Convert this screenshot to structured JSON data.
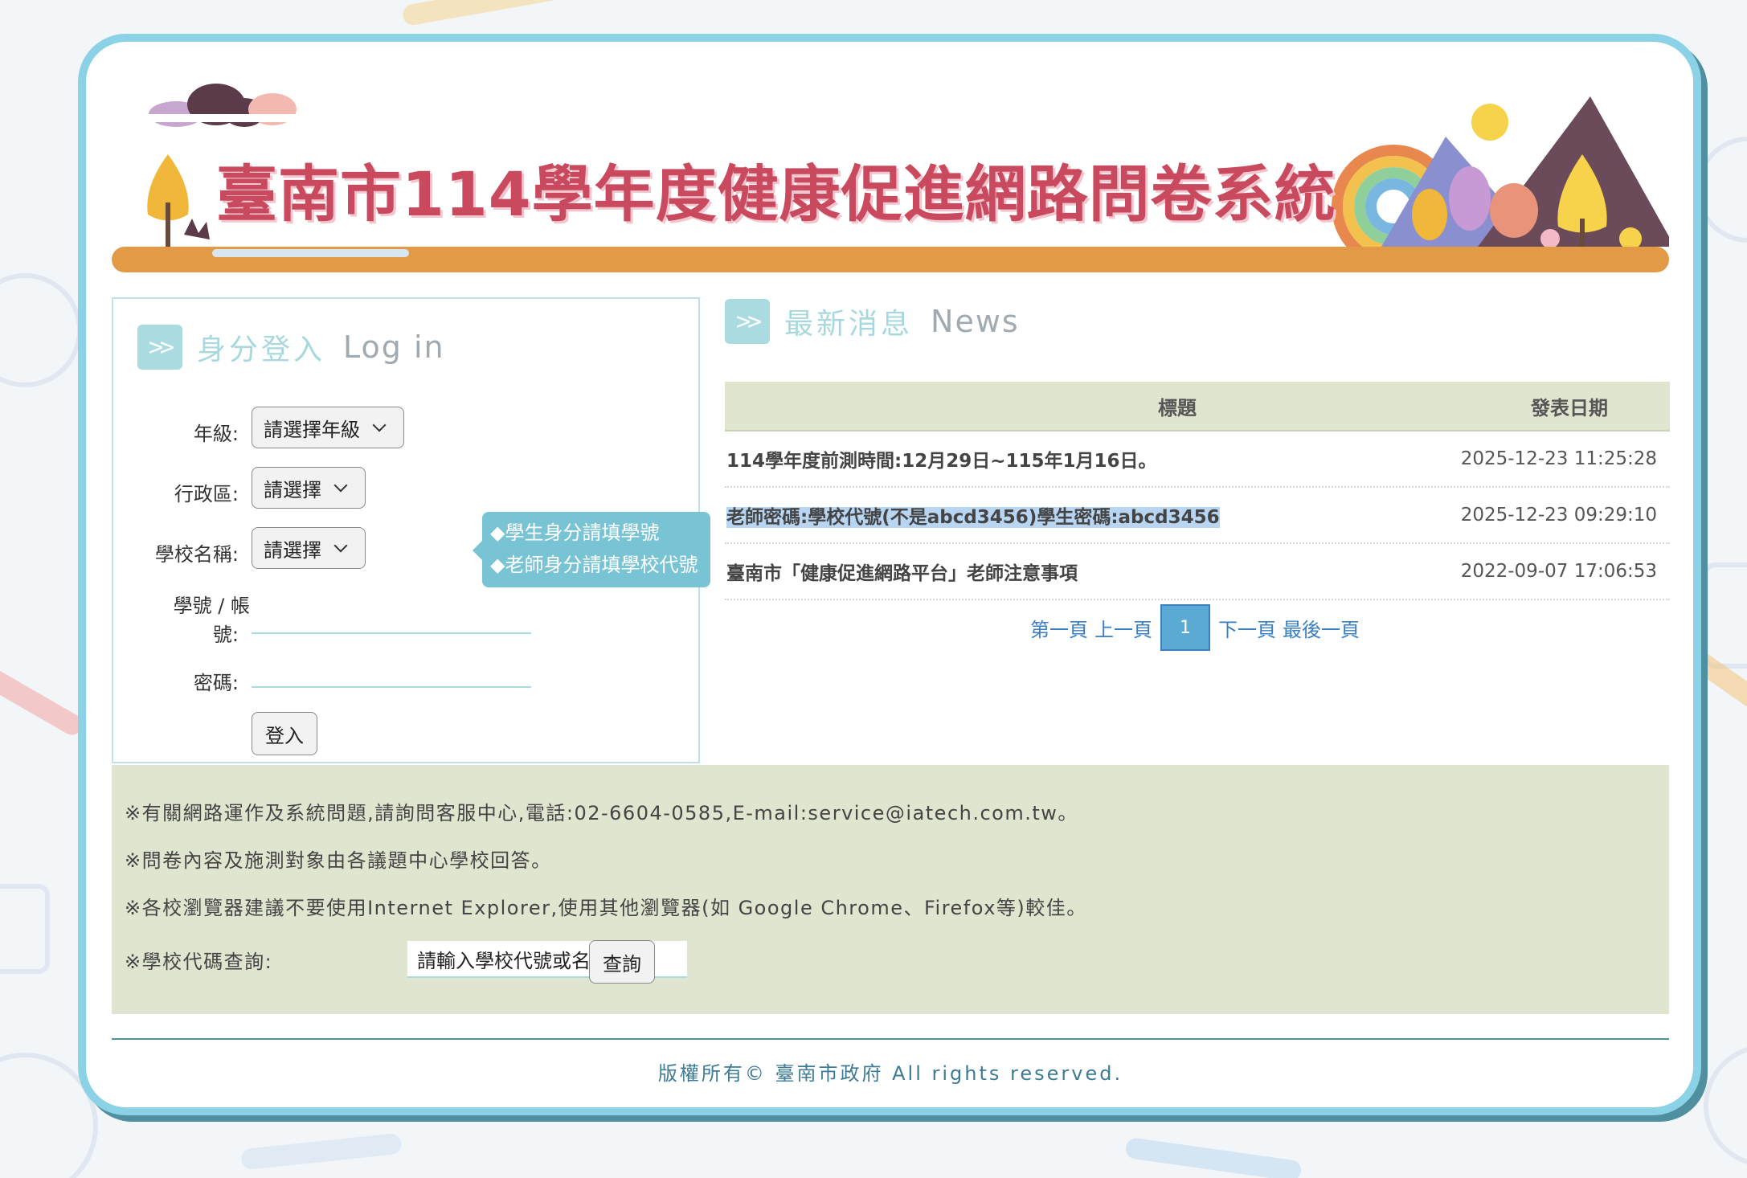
{
  "banner": {
    "title": "臺南市114學年度健康促進網路問卷系統"
  },
  "login": {
    "heading_zh": "身分登入",
    "heading_en": "Log in",
    "grade_label": "年級:",
    "grade_value": "請選擇年級",
    "district_label": "行政區:",
    "district_value": "請選擇",
    "school_label": "學校名稱:",
    "school_value": "請選擇",
    "account_label_1": "學號 / 帳",
    "account_label_2": "號:",
    "password_label": "密碼:",
    "login_button": "登入",
    "tooltip_1": "◆學生身分請填學號",
    "tooltip_2": "◆老師身分請填學校代號"
  },
  "news": {
    "heading_zh": "最新消息",
    "heading_en": "News",
    "col_title": "標題",
    "col_date": "發表日期",
    "rows": [
      {
        "title": "114學年度前測時間:12月29日~115年1月16日。",
        "date": "2025-12-23 11:25:28"
      },
      {
        "title": "老師密碼:學校代號(不是abcd3456)學生密碼:abcd3456",
        "date": "2025-12-23 09:29:10"
      },
      {
        "title": "臺南市「健康促進網路平台」老師注意事項",
        "date": "2022-09-07 17:06:53"
      }
    ],
    "pager": {
      "first": "第一頁",
      "prev": "上一頁",
      "current": "1",
      "next": "下一頁",
      "last": "最後一頁"
    }
  },
  "info": {
    "line1": "※有關網路運作及系統問題,請詢問客服中心,電話:02-6604-0585,E-mail:service@iatech.com.tw。",
    "line2": "※問卷內容及施測對象由各議題中心學校回答。",
    "line3": "※各校瀏覽器建議不要使用Internet Explorer,使用其他瀏覽器(如 Google Chrome、Firefox等)較佳。",
    "school_query_label": "※學校代碼查詢:",
    "school_query_placeholder": "請輸入學校代號或名稱",
    "query_button": "查詢"
  },
  "footer": {
    "copyright": "版權所有© 臺南市政府 All rights reserved."
  },
  "colors": {
    "frame": "#8cd2e6",
    "banner_title": "#c94a5e",
    "banner_bar": "#e39a47",
    "info_bg": "#dfe5cf",
    "link": "#3a7fc1"
  }
}
